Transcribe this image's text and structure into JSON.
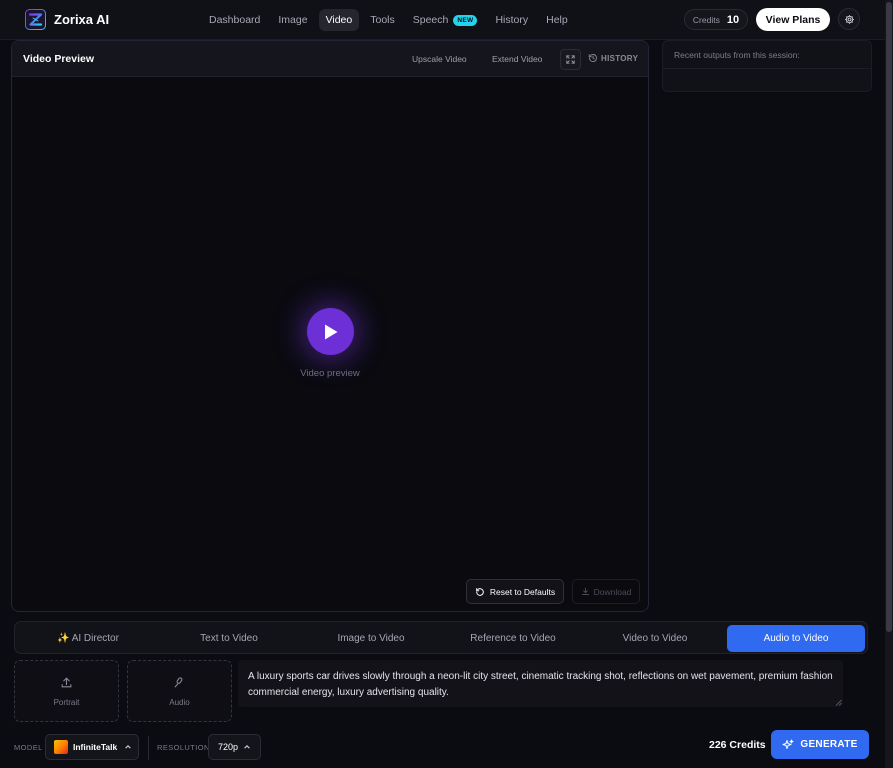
{
  "app": {
    "brand": "Zorixa AI",
    "accent_color": "#7c3aed",
    "primary_color": "#2f6af0"
  },
  "nav": {
    "items": [
      {
        "label": "Dashboard",
        "active": false
      },
      {
        "label": "Image",
        "active": false
      },
      {
        "label": "Video",
        "active": true
      },
      {
        "label": "Tools",
        "active": false
      },
      {
        "label": "Speech",
        "active": false,
        "badge": "NEW"
      },
      {
        "label": "History",
        "active": false
      },
      {
        "label": "Help",
        "active": false
      }
    ]
  },
  "account": {
    "credits_label": "Credits",
    "credits_value": "10",
    "plans_button": "View Plans",
    "settings_icon": "gear-icon"
  },
  "preview": {
    "title": "Video Preview",
    "upscale_label": "Upscale Video",
    "extend_label": "Extend Video",
    "expand_icon": "expand-icon",
    "history_label": "HISTORY",
    "caption": "Video preview",
    "reset_label": "Reset to Defaults",
    "download_label": "Download"
  },
  "side": {
    "text": "Recent outputs from this session:"
  },
  "mode_tabs": [
    {
      "label": "✨ AI Director",
      "active": false
    },
    {
      "label": "Text to Video",
      "active": false
    },
    {
      "label": "Image to Video",
      "active": false
    },
    {
      "label": "Reference to Video",
      "active": false
    },
    {
      "label": "Video to Video",
      "active": false
    },
    {
      "label": "Audio to Video",
      "active": true
    }
  ],
  "inputs": {
    "portrait_label": "Portrait",
    "audio_label": "Audio",
    "prompt": "A luxury sports car drives slowly through a neon-lit city street, cinematic tracking shot, reflections on wet pavement, premium fashion commercial energy, luxury advertising quality."
  },
  "footer": {
    "model_label": "MODEL",
    "model_value": "InfiniteTalk",
    "resolution_label": "RESOLUTION",
    "resolution_value": "720p",
    "credits_cost": "226 Credits",
    "generate_label": "GENERATE"
  }
}
